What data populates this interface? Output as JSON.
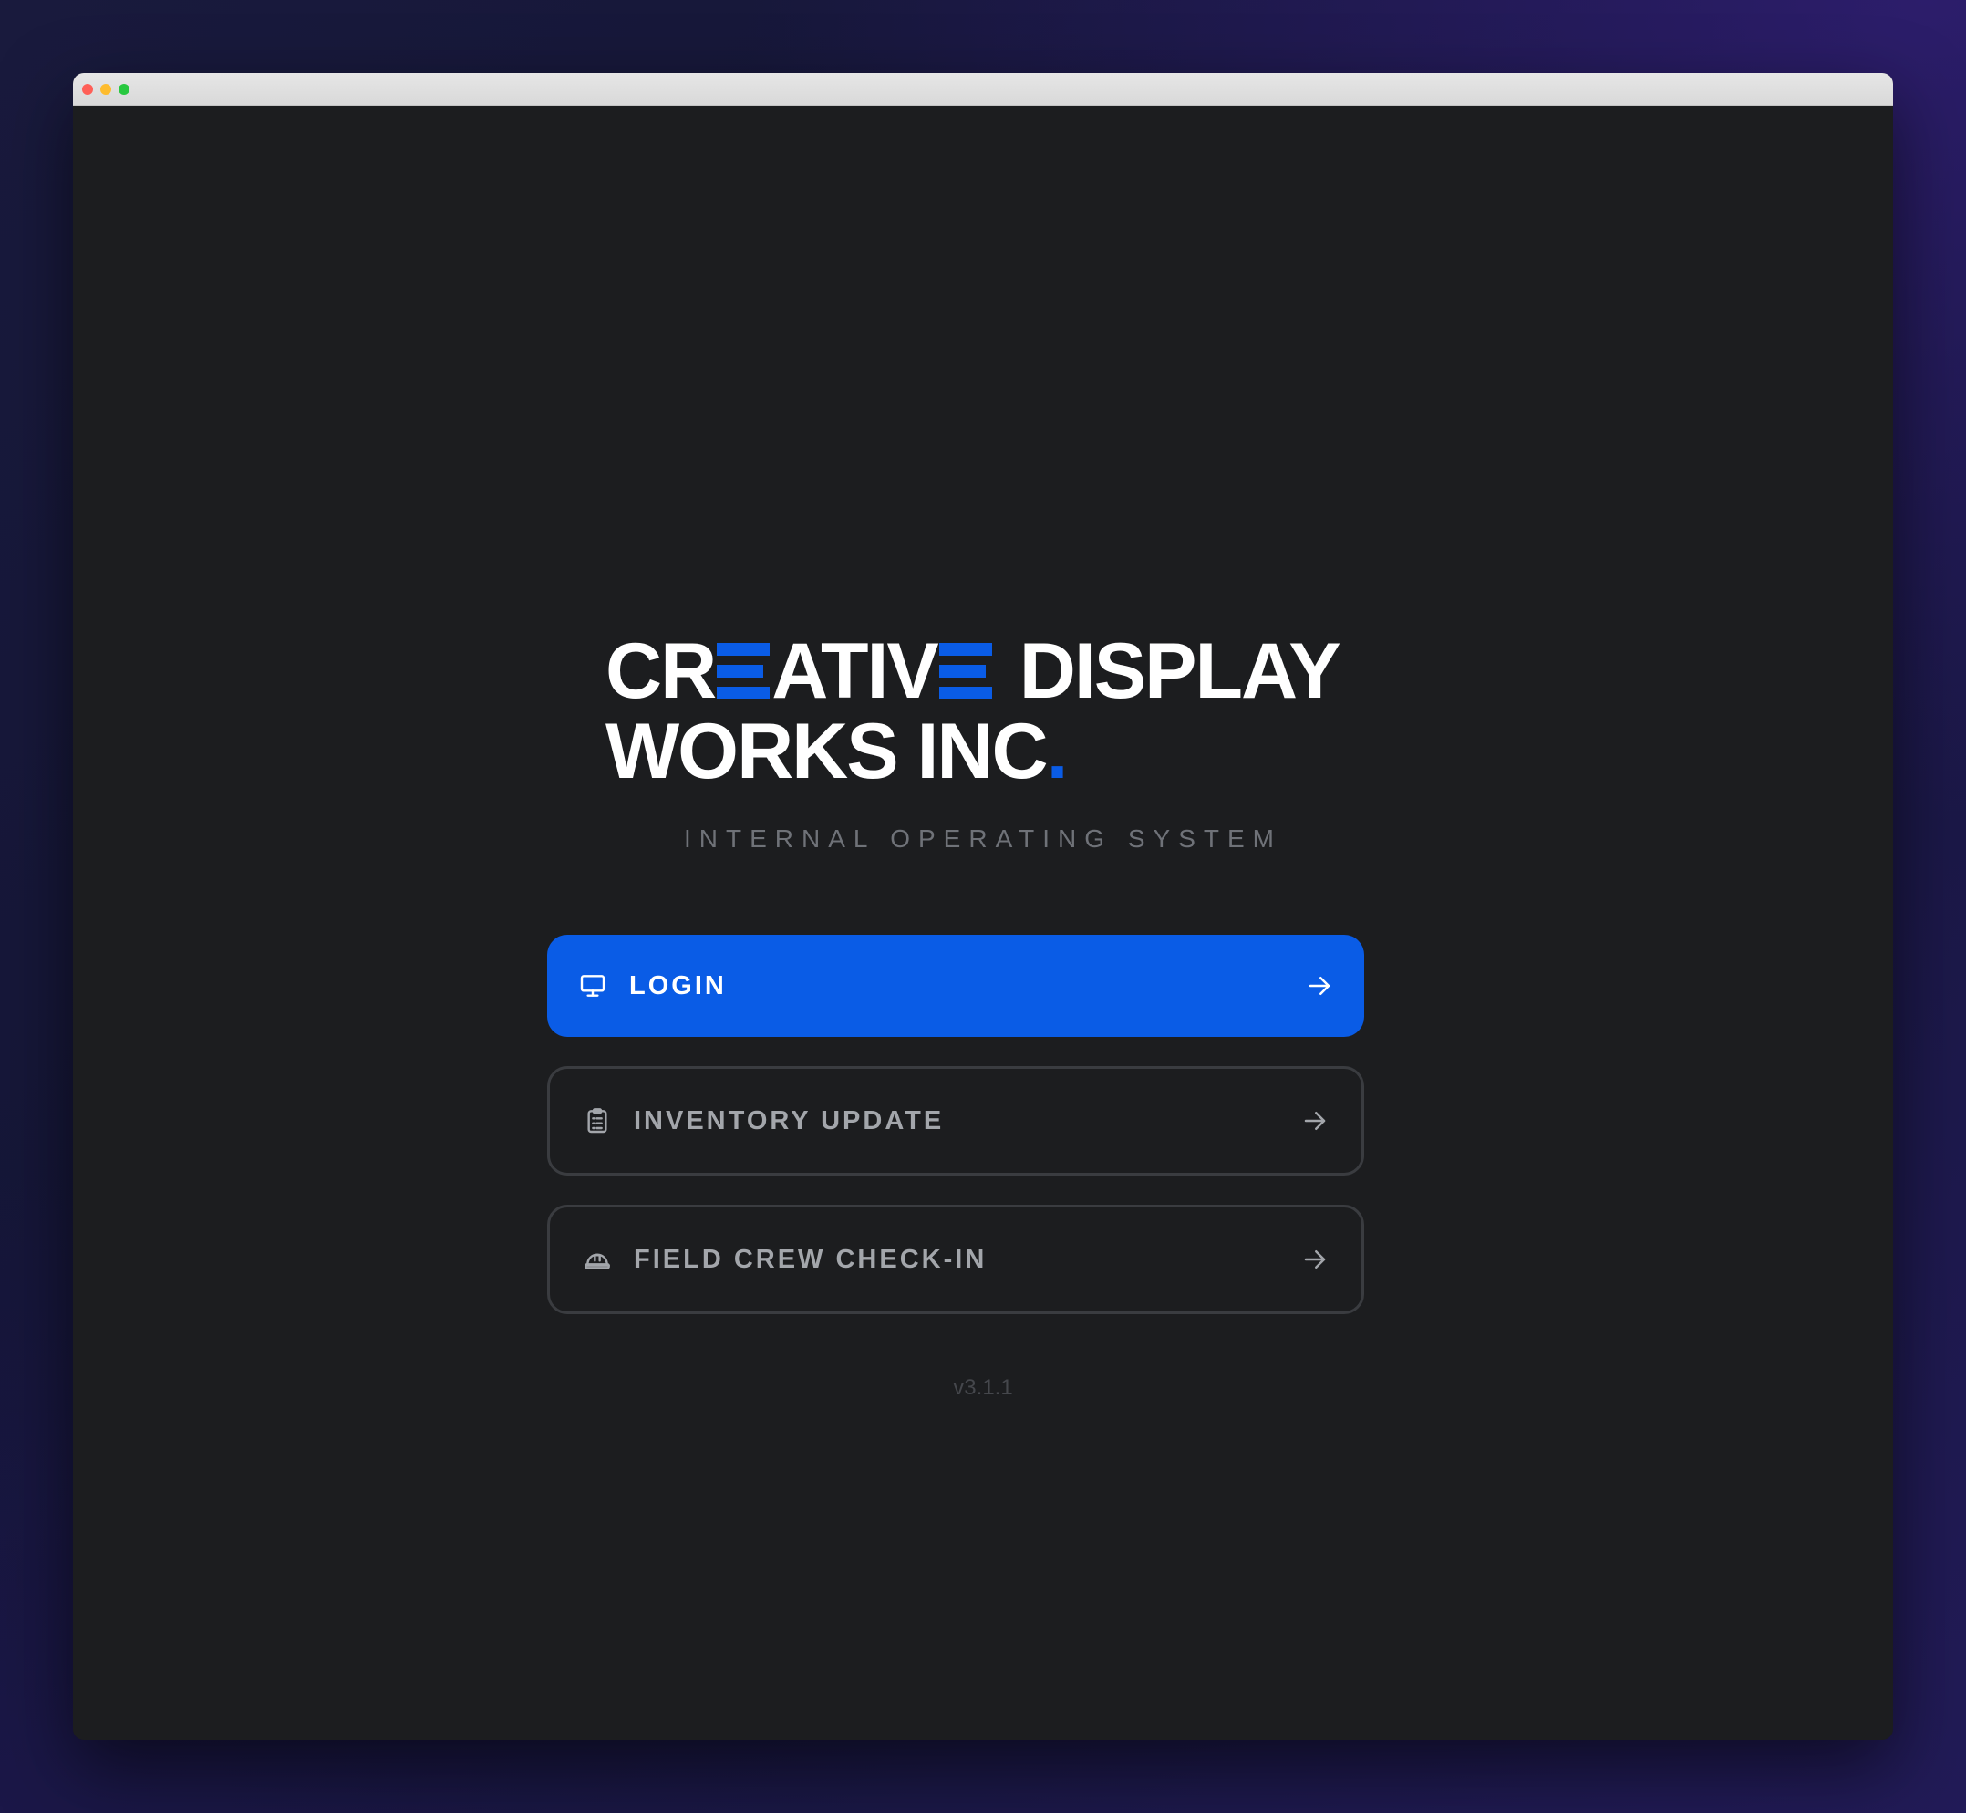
{
  "brand": {
    "line1_part1": "CR",
    "line1_part2": "ATIV",
    "line1_part3": "DISPLAY",
    "line2": "WORKS INC",
    "period": ".",
    "accent_color": "#0a5ce6"
  },
  "subtitle": "INTERNAL OPERATING SYSTEM",
  "actions": [
    {
      "label": "LOGIN",
      "icon": "monitor-icon",
      "style": "primary"
    },
    {
      "label": "INVENTORY UPDATE",
      "icon": "clipboard-list-icon",
      "style": "secondary"
    },
    {
      "label": "FIELD CREW CHECK-IN",
      "icon": "hard-hat-icon",
      "style": "secondary"
    }
  ],
  "version": "v3.1.1"
}
